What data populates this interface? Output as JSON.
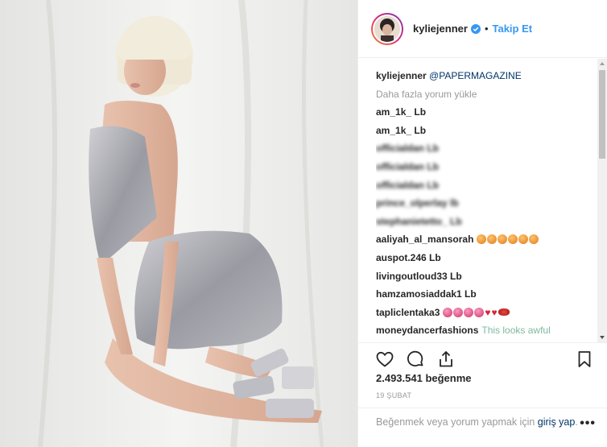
{
  "header": {
    "username": "kyliejenner",
    "separator": "•",
    "follow_label": "Takip Et"
  },
  "post": {
    "caption_user": "kyliejenner",
    "caption_text": "@PAPERMAGAZINE",
    "load_more": "Daha fazla yorum yükle",
    "comments": [
      {
        "user": "am_1k_ Lb",
        "text": "",
        "emoji": []
      },
      {
        "user": "am_1k_ Lb",
        "text": "",
        "emoji": []
      },
      {
        "user": "officialdan Lb",
        "text": "",
        "emoji": []
      },
      {
        "user": "officialdan Lb",
        "text": "",
        "emoji": []
      },
      {
        "user": "officialdan Lb",
        "text": "",
        "emoji": []
      },
      {
        "user": "prince_olperlay lb",
        "text": "",
        "emoji": []
      },
      {
        "user": "stephanietetto_ Lb",
        "text": "",
        "emoji": []
      },
      {
        "user": "aaliyah_al_mansorah",
        "text": "",
        "emoji": [
          "orange",
          "orange",
          "orange",
          "orange",
          "orange",
          "orange"
        ]
      },
      {
        "user": "auspot.246 Lb",
        "text": "",
        "emoji": []
      },
      {
        "user": "livingoutloud33 Lb",
        "text": "",
        "emoji": []
      },
      {
        "user": "hamzamosiaddak1 Lb",
        "text": "",
        "emoji": []
      },
      {
        "user": "tapliclentaka3",
        "text": "",
        "emoji": [
          "pink",
          "pink",
          "pink",
          "pink",
          "heart",
          "heart",
          "lips"
        ]
      },
      {
        "user": "moneydancerfashions",
        "text": "This looks awful",
        "emoji": []
      }
    ],
    "likes": "2.493.541 beğenme",
    "date": "19 ŞUBAT",
    "footer_text": "Beğenmek veya yorum yapmak için ",
    "footer_link": "giriş yap",
    "footer_end": ".",
    "more": "•••"
  },
  "icons": {
    "verified": "verified-badge-icon",
    "like": "heart-outline-icon",
    "comment": "comment-bubble-icon",
    "share": "share-upload-icon",
    "save": "bookmark-icon",
    "more": "more-dots-icon"
  },
  "colors": {
    "link_blue": "#3897f0",
    "mention": "#003569",
    "muted": "#999999",
    "text": "#262626"
  }
}
